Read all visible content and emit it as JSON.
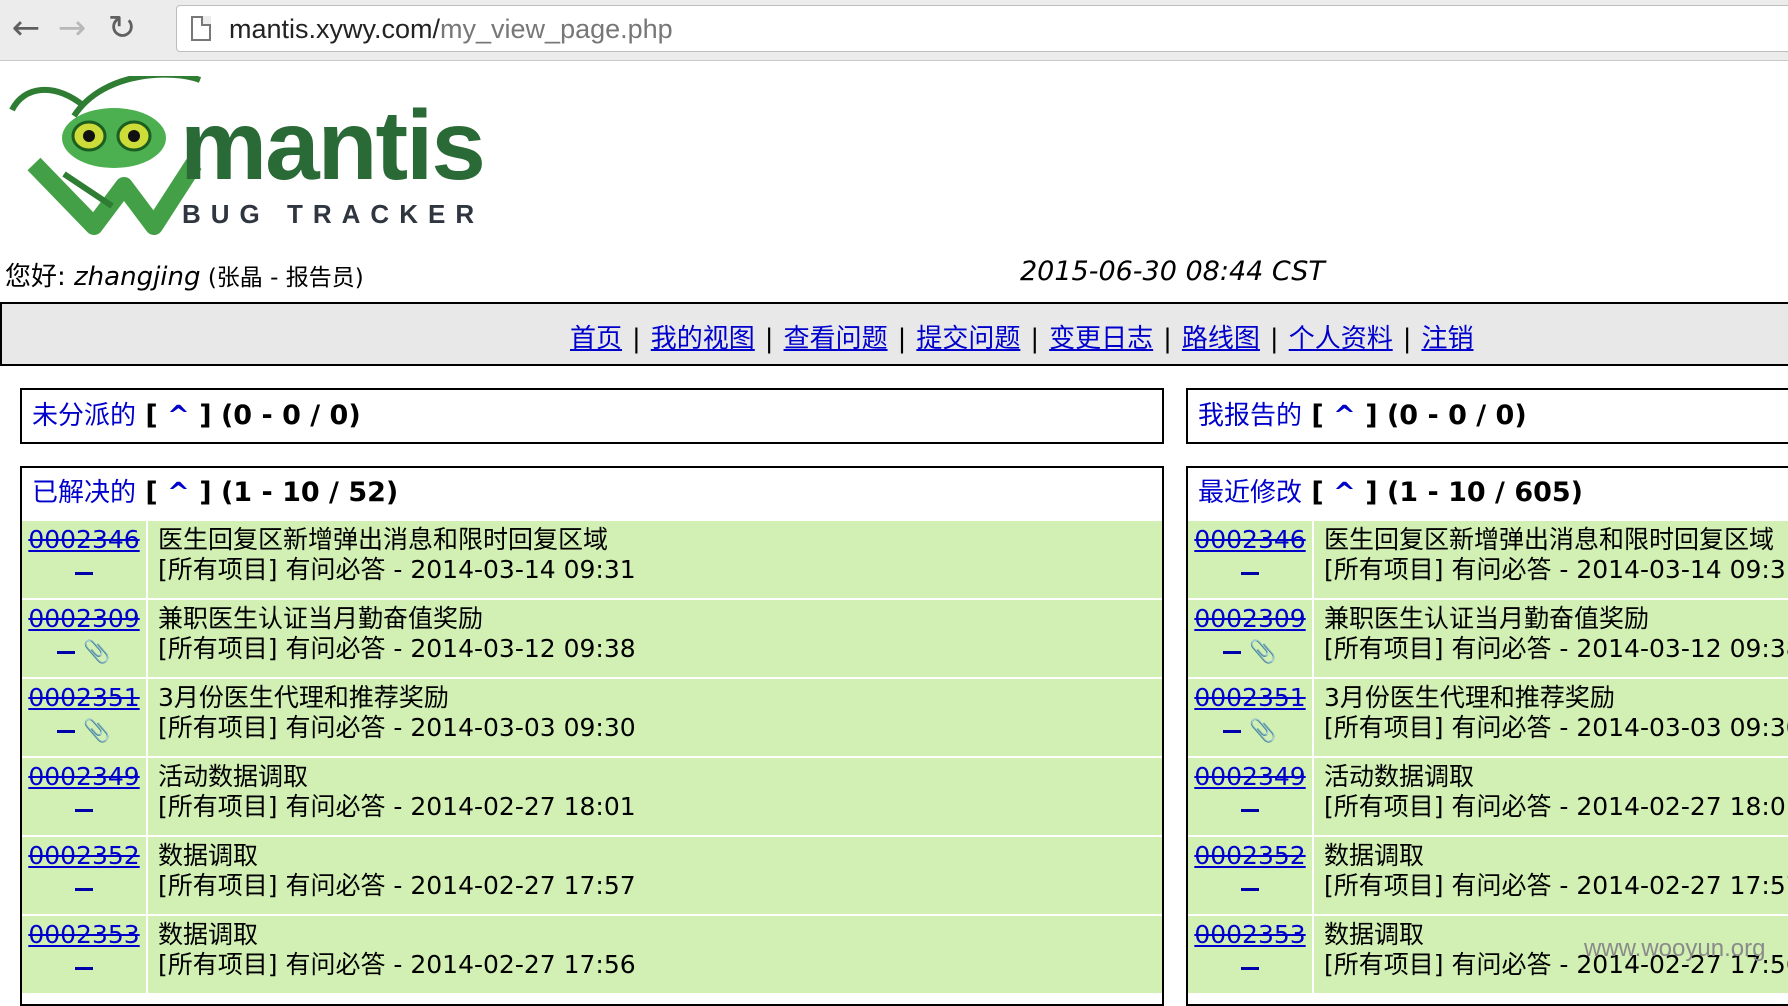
{
  "browser": {
    "back_icon": "←",
    "forward_icon": "→",
    "reload_icon": "↻",
    "url_host": "mantis.xywy.com/",
    "url_path": "my_view_page.php"
  },
  "logo": {
    "word": "mantis",
    "sub": "BUG TRACKER"
  },
  "greeting": {
    "prefix": "您好: ",
    "username": "zhangjing",
    "role": " (张晶 - 报告员)",
    "datetime": "2015-06-30 08:44 CST"
  },
  "menu": {
    "items": [
      "首页",
      "我的视图",
      "查看问题",
      "提交问题",
      "变更日志",
      "路线图",
      "个人资料",
      "注销"
    ],
    "separator": "|"
  },
  "panels": {
    "unassigned": {
      "title": "未分派的",
      "open": "[",
      "caret": "^",
      "close": "]",
      "count": "(0 - 0 / 0)"
    },
    "reported": {
      "title": "我报告的",
      "open": "[",
      "caret": "^",
      "close": "]",
      "count": "(0 - 0 / 0)"
    },
    "resolved": {
      "title": "已解决的",
      "open": "[",
      "caret": "^",
      "close": "]",
      "count": "(1 - 10 / 52)"
    },
    "recent": {
      "title": "最近修改",
      "open": "[",
      "caret": "^",
      "close": "]",
      "count": "(1 - 10 / 605)"
    }
  },
  "bugs": [
    {
      "id": "0002346",
      "summary": "医生回复区新增弹出消息和限时回复区域",
      "meta": "[所有项目] 有问必答 - 2014-03-14 09:31",
      "attachment": false
    },
    {
      "id": "0002309",
      "summary": "兼职医生认证当月勤奋值奖励",
      "meta": "[所有项目] 有问必答 - 2014-03-12 09:38",
      "attachment": true
    },
    {
      "id": "0002351",
      "summary": "3月份医生代理和推荐奖励",
      "meta": "[所有项目] 有问必答 - 2014-03-03 09:30",
      "attachment": true
    },
    {
      "id": "0002349",
      "summary": "活动数据调取",
      "meta": "[所有项目] 有问必答 - 2014-02-27 18:01",
      "attachment": false
    },
    {
      "id": "0002352",
      "summary": "数据调取",
      "meta": "[所有项目] 有问必答 - 2014-02-27 17:57",
      "attachment": false
    },
    {
      "id": "0002353",
      "summary": "数据调取",
      "meta": "[所有项目] 有问必答 - 2014-02-27 17:56",
      "attachment": false
    }
  ],
  "watermark": "www.wooyun.org",
  "colors": {
    "row_bg": "#d2f0b4",
    "link": "#0000cc",
    "logo_green": "#2a6a36"
  }
}
